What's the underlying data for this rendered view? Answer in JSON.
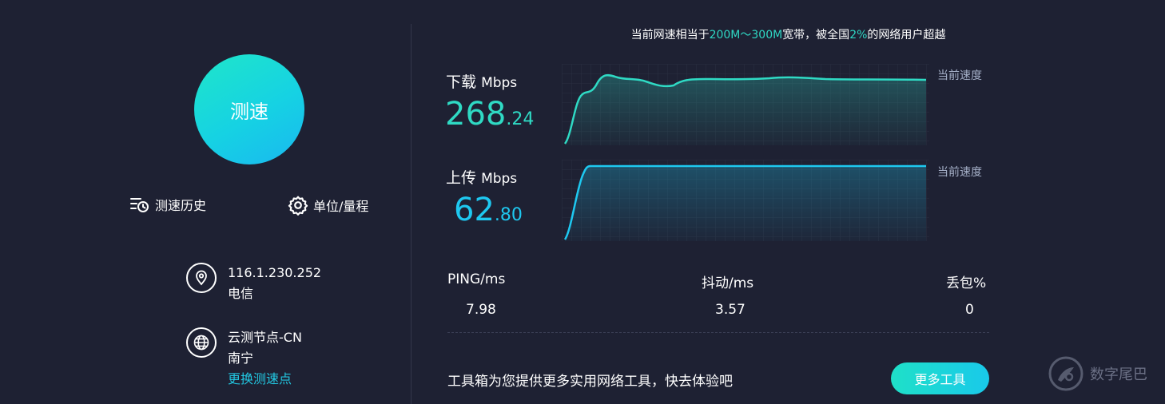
{
  "left": {
    "speed_button": "测速",
    "history_label": "测速历史",
    "unit_label": "单位/量程",
    "ip": "116.1.230.252",
    "isp": "电信",
    "node_name": "云测节点-CN",
    "node_city": "南宁",
    "change_node": "更换测速点"
  },
  "summary": {
    "prefix": "当前网速相当于",
    "bandwidth": "200M～300M",
    "middle": "宽带，被全国",
    "percent": "2%",
    "suffix": "的网络用户超越"
  },
  "download": {
    "label": "下载",
    "unit": "Mbps",
    "int": "268",
    "dec": ".24",
    "current_label": "当前速度"
  },
  "upload": {
    "label": "上传",
    "unit": "Mbps",
    "int": "62",
    "dec": ".80",
    "current_label": "当前速度"
  },
  "stats": {
    "ping_label": "PING/ms",
    "ping": "7.98",
    "jitter_label": "抖动/ms",
    "jitter": "3.57",
    "loss_label": "丢包%",
    "loss": "0"
  },
  "promo": {
    "text": "工具箱为您提供更多实用网络工具，快去体验吧",
    "button": "更多工具"
  },
  "watermark": "数字尾巴",
  "colors": {
    "background": "#1e2133",
    "download": "#2fdac4",
    "upload": "#1ec8f0",
    "link": "#22c6e0",
    "muted": "#a6b1c9"
  }
}
